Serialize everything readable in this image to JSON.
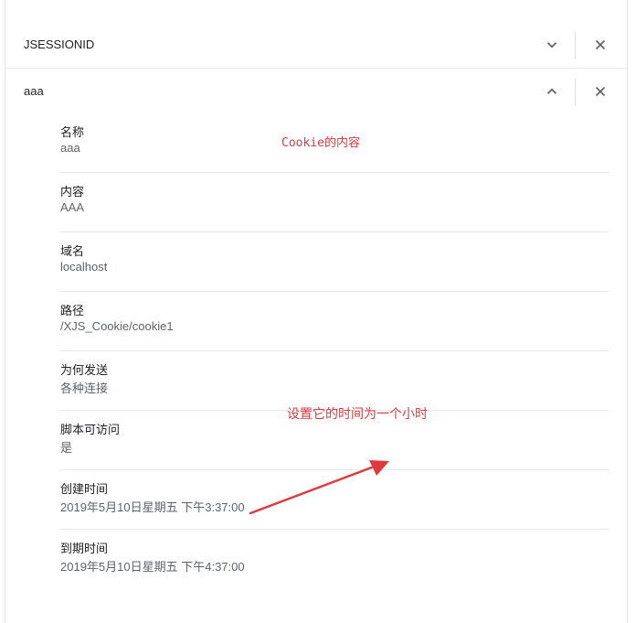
{
  "cookies": [
    {
      "name": "JSESSIONID",
      "expanded": false
    },
    {
      "name": "aaa",
      "expanded": true
    }
  ],
  "icons": {
    "collapsed": "chevron-down-icon",
    "expanded": "chevron-up-icon",
    "remove": "close-icon"
  },
  "details": [
    {
      "label": "名称",
      "value": "aaa"
    },
    {
      "label": "内容",
      "value": "AAA"
    },
    {
      "label": "域名",
      "value": "localhost"
    },
    {
      "label": "路径",
      "value": "/XJS_Cookie/cookie1"
    },
    {
      "label": "为何发送",
      "value": "各种连接"
    },
    {
      "label": "脚本可访问",
      "value": "是"
    },
    {
      "label": "创建时间",
      "value": "2019年5月10日星期五 下午3:37:00"
    },
    {
      "label": "到期时间",
      "value": "2019年5月10日星期五 下午4:37:00"
    }
  ],
  "annotations": {
    "content_note": "Cookie的内容",
    "expiry_note": "设置它的时间为一个小时",
    "color": "#e0393e"
  }
}
